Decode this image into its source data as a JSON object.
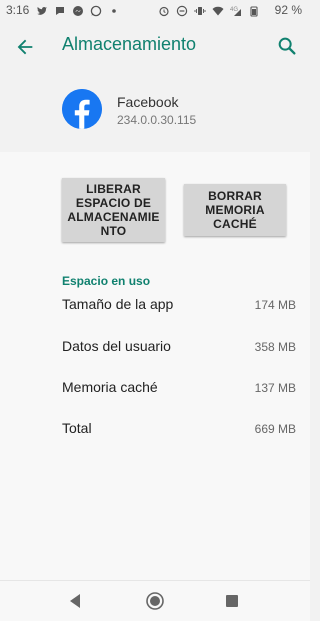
{
  "status_bar": {
    "time": "3:16",
    "battery_text": "92 %",
    "left_icons": [
      "twitter-icon",
      "chat-icon",
      "messenger-icon",
      "whatsapp-icon",
      "dot-icon"
    ],
    "right_icons": [
      "alarm-icon",
      "minus-circle-icon",
      "vibrate-icon",
      "wifi-icon",
      "signal-4g-icon",
      "signal-icon"
    ]
  },
  "app_bar": {
    "title": "Almacenamiento"
  },
  "app_info": {
    "name": "Facebook",
    "version": "234.0.0.30.115"
  },
  "actions": {
    "liberar_label": "LIBERAR\nESPACIO DE\nALMACENAMIE\nNTO",
    "borrar_label": "BORRAR\nMEMORIA\nCACHÉ"
  },
  "storage": {
    "section_title": "Espacio en uso",
    "rows": [
      {
        "label": "Tamaño de la app",
        "value": "174 MB"
      },
      {
        "label": "Datos del usuario",
        "value": "358 MB"
      },
      {
        "label": "Memoria caché",
        "value": "137 MB"
      },
      {
        "label": "Total",
        "value": "669 MB"
      }
    ]
  },
  "colors": {
    "accent": "#10816f",
    "facebook": "#1877f2"
  }
}
